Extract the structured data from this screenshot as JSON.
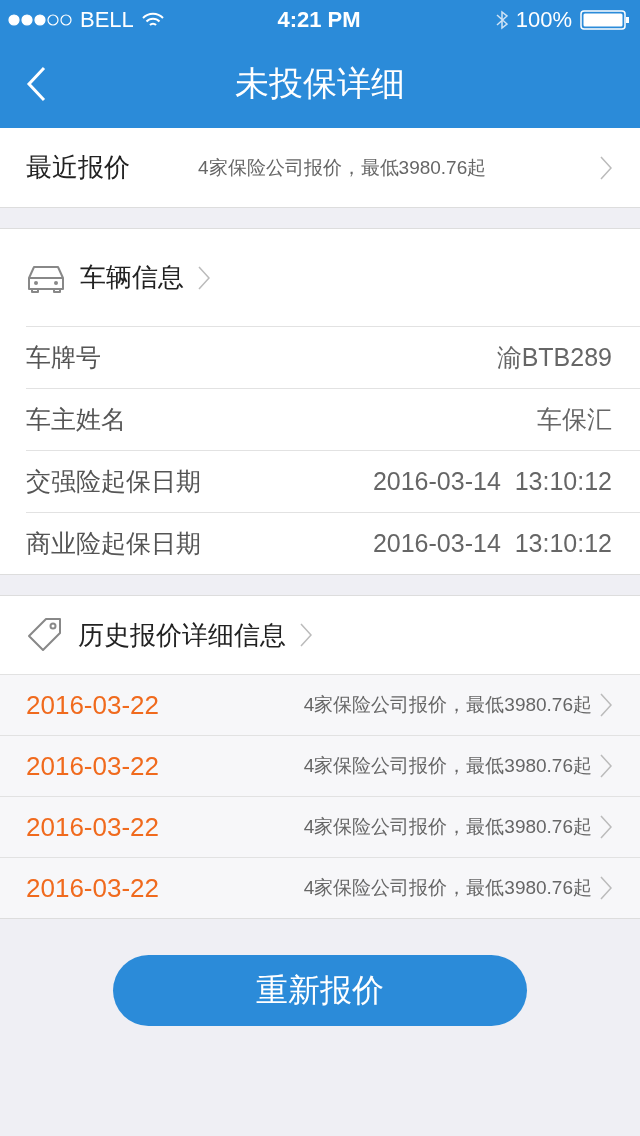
{
  "status_bar": {
    "carrier": "BELL",
    "time": "4:21 PM",
    "battery": "100%"
  },
  "nav": {
    "title": "未投保详细"
  },
  "recent": {
    "label": "最近报价",
    "summary": "4家保险公司报价，最低3980.76起"
  },
  "vehicle": {
    "title": "车辆信息",
    "rows": [
      {
        "label": "车牌号",
        "value": "渝BTB289"
      },
      {
        "label": "车主姓名",
        "value": "车保汇"
      },
      {
        "label": "交强险起保日期",
        "value": "2016-03-14  13:10:12"
      },
      {
        "label": "商业险起保日期",
        "value": "2016-03-14  13:10:12"
      }
    ]
  },
  "history": {
    "title": "历史报价详细信息",
    "rows": [
      {
        "date": "2016-03-22",
        "summary": "4家保险公司报价，最低3980.76起"
      },
      {
        "date": "2016-03-22",
        "summary": "4家保险公司报价，最低3980.76起"
      },
      {
        "date": "2016-03-22",
        "summary": "4家保险公司报价，最低3980.76起"
      },
      {
        "date": "2016-03-22",
        "summary": "4家保险公司报价，最低3980.76起"
      }
    ]
  },
  "button": "重新报价"
}
